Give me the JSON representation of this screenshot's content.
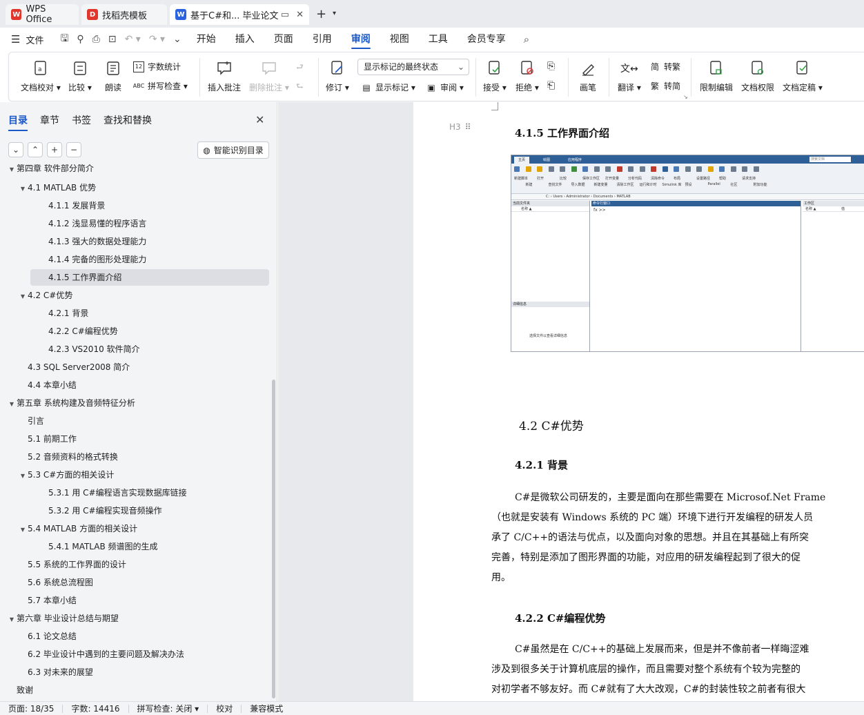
{
  "tabs": [
    {
      "label": "WPS Office",
      "logo": "W",
      "color": "#e0362c"
    },
    {
      "label": "找稻壳模板",
      "logo": "D",
      "color": "#e0362c"
    },
    {
      "label": "基于C#和... 毕业论文",
      "logo": "W",
      "color": "#2b62e0"
    }
  ],
  "menu": {
    "file": "文件",
    "tabs": [
      "开始",
      "插入",
      "页面",
      "引用",
      "审阅",
      "视图",
      "工具",
      "会员专享"
    ],
    "active_tab": "审阅"
  },
  "ribbon": {
    "doc_proof": "文档校对",
    "compare": "比较",
    "read_aloud": "朗读",
    "word_count": "字数统计",
    "spell_check": "拼写检查",
    "insert_comment": "插入批注",
    "delete_comment": "删除批注",
    "track_changes": "修订",
    "markup_state": "显示标记的最终状态",
    "show_markup": "显示标记",
    "review_pane": "审阅",
    "accept": "接受",
    "reject": "拒绝",
    "pen": "画笔",
    "translate": "翻译",
    "to_traditional": "转繁",
    "to_simplified": "转简",
    "restrict_edit": "限制编辑",
    "doc_permission": "文档权限",
    "doc_finalize": "文档定稿"
  },
  "nav": {
    "tabs": [
      "目录",
      "章节",
      "书签",
      "查找和替换"
    ],
    "smart_toc": "智能识别目录",
    "toc": [
      {
        "label": "第四章  软件部分简介",
        "level": 1,
        "caret": "down",
        "partial": true
      },
      {
        "label": "4.1 MATLAB 优势",
        "level": 2,
        "caret": "down"
      },
      {
        "label": "4.1.1 发展背景",
        "level": 3
      },
      {
        "label": "4.1.2  浅显易懂的程序语言",
        "level": 3
      },
      {
        "label": "4.1.3  强大的数据处理能力",
        "level": 3
      },
      {
        "label": "4.1.4  完备的图形处理能力",
        "level": 3
      },
      {
        "label": "4.1.5  工作界面介绍",
        "level": 3,
        "active": true
      },
      {
        "label": "4.2 C#优势",
        "level": 2,
        "caret": "down"
      },
      {
        "label": "4.2.1 背景",
        "level": 3
      },
      {
        "label": "4.2.2 C#编程优势",
        "level": 3
      },
      {
        "label": "4.2.3 VS2010 软件简介",
        "level": 3
      },
      {
        "label": "4.3 SQL Server2008 简介",
        "level": 2
      },
      {
        "label": "4.4  本章小结",
        "level": 2
      },
      {
        "label": "第五章  系统构建及音频特征分析",
        "level": 1,
        "caret": "down"
      },
      {
        "label": "引言",
        "level": 2
      },
      {
        "label": "5.1  前期工作",
        "level": 2
      },
      {
        "label": "5.2  音频资料的格式转换",
        "level": 2
      },
      {
        "label": "5.3 C#方面的相关设计",
        "level": 2,
        "caret": "down"
      },
      {
        "label": "5.3.1 用 C#编程语言实现数据库链接",
        "level": 3
      },
      {
        "label": "5.3.2  用 C#编程实现音频操作",
        "level": 3
      },
      {
        "label": "5.4 MATLAB 方面的相关设计",
        "level": 2,
        "caret": "down"
      },
      {
        "label": "5.4.1 MATLAB 频谱图的生成",
        "level": 3
      },
      {
        "label": "5.5 系统的工作界面的设计",
        "level": 2
      },
      {
        "label": "5.6  系统总流程图",
        "level": 2
      },
      {
        "label": "5.7  本章小结",
        "level": 2
      },
      {
        "label": "第六章  毕业设计总结与期望",
        "level": 1,
        "caret": "down"
      },
      {
        "label": "6.1 论文总结",
        "level": 2
      },
      {
        "label": "6.2  毕业设计中遇到的主要问题及解决办法",
        "level": 2
      },
      {
        "label": "6.3  对未来的展望",
        "level": 2
      },
      {
        "label": "致谢",
        "level": 1
      }
    ]
  },
  "document": {
    "heading_marker": "H3",
    "h_415": "4.1.5  工作界面介绍",
    "h_42": "4.2 C#优势",
    "h_421": "4.2.1 背景",
    "p1": [
      "C#是微软公司研发的，主要是面向在那些需要在 Microsof.Net Frame",
      "（也就是安装有 Windows 系统的 PC 端）环境下进行开发编程的研发人员",
      "承了 C/C++的语法与优点，以及面向对象的思想。并且在其基础上有所突",
      "完善，特别是添加了图形界面的功能，对应用的研发编程起到了很大的促",
      "用。"
    ],
    "h_422": "4.2.2 C#编程优势",
    "p2": [
      "C#虽然是在 C/C++的基础上发展而来，但是并不像前者一样晦涩难",
      "涉及到很多关于计算机底层的操作，而且需要对整个系统有个较为完整的",
      "对初学者不够友好。而 C#就有了大大改观，C#的封装性较之前者有很大"
    ]
  },
  "matlab_shot": {
    "tabs": [
      "主页",
      "绘图",
      "应用程序"
    ],
    "search": "搜索文档",
    "tools": [
      "新建脚本",
      "新建",
      "打开",
      "查找文件",
      "比较",
      "导入数据",
      "保存工作区",
      "新建变量",
      "打开变量",
      "清除工作区",
      "分析代码",
      "运行和计时",
      "清除命令",
      "Simulink 库",
      "布局",
      "预设",
      "设置路径",
      "Parallel",
      "帮助",
      "社区",
      "请求支持",
      "附加功能"
    ],
    "path": "C: › Users › Administrator › Documents › MATLAB",
    "current_folder": "当前文件夹",
    "name_col": "名称 ▲",
    "command_window": "命令行窗口",
    "prompt": "fx >>",
    "workspace": "工作区",
    "ws_name": "名称 ▲",
    "ws_value": "值",
    "details": "详细信息",
    "details_hint": "选择文件以查看详细信息"
  },
  "status": {
    "page": "页面: 18/35",
    "words": "字数: 14416",
    "spell": "拼写检查: 关闭",
    "proof": "校对",
    "compat": "兼容模式"
  },
  "colors": {
    "accent": "#1a57c7",
    "wps_red": "#e0362c",
    "matlab_blue": "#2f5f97"
  }
}
